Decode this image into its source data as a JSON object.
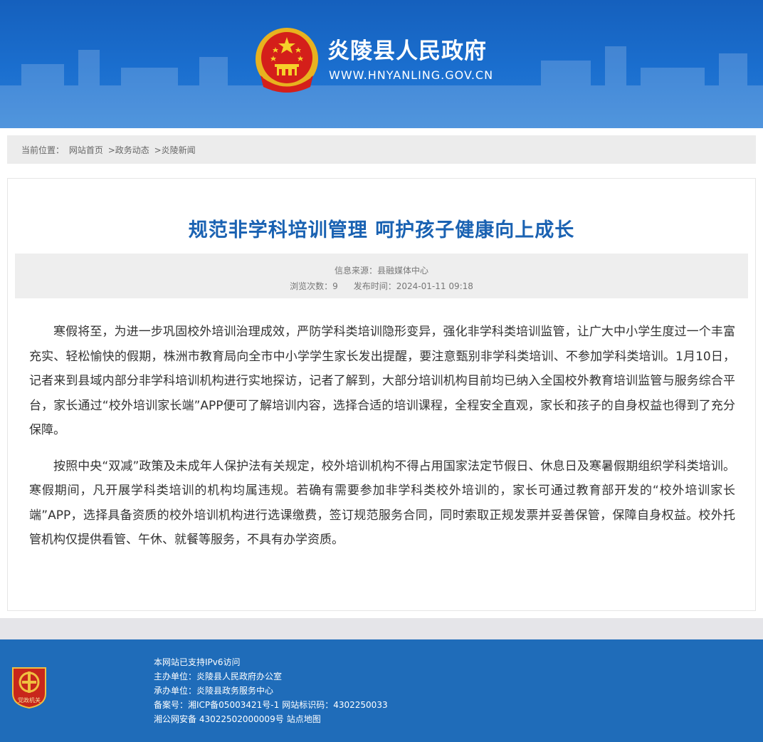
{
  "header": {
    "title": "炎陵县人民政府",
    "url": "WWW.HNYANLING.GOV.CN",
    "emblem_icon": "national-emblem-icon"
  },
  "breadcrumb": {
    "label": "当前位置：",
    "items": [
      "网站首页",
      ">政务动态",
      ">炎陵新闻"
    ]
  },
  "article": {
    "title": "规范非学科培训管理 呵护孩子健康向上成长",
    "source_label": "信息来源：",
    "source": "县融媒体中心",
    "views_label": "浏览次数：",
    "views": "9",
    "published_label": "发布时间：",
    "published": "2024-01-11 09:18",
    "paragraphs": [
      "寒假将至，为进一步巩固校外培训治理成效，严防学科类培训隐形变异，强化非学科类培训监管，让广大中小学生度过一个丰富充实、轻松愉快的假期，株洲市教育局向全市中小学学生家长发出提醒，要注意甄别非学科类培训、不参加学科类培训。1月10日，记者来到县域内部分非学科培训机构进行实地探访，记者了解到，大部分培训机构目前均已纳入全国校外教育培训监管与服务综合平台，家长通过“校外培训家长端”APP便可了解培训内容，选择合适的培训课程，全程安全直观，家长和孩子的自身权益也得到了充分保障。",
      "按照中央“双减”政策及未成年人保护法有关规定，校外培训机构不得占用国家法定节假日、休息日及寒暑假期组织学科类培训。寒假期间，凡开展学科类培训的机构均属违规。若确有需要参加非学科类校外培训的，家长可通过教育部开发的“校外培训家长端”APP，选择具备资质的校外培训机构进行选课缴费，签订规范服务合同，同时索取正规发票并妥善保管，保障自身权益。校外托管机构仅提供看管、午休、就餐等服务，不具有办学资质。"
    ]
  },
  "footer": {
    "ipv6": "本网站已支持IPv6访问",
    "host_label": "主办单位：",
    "host": "炎陵县人民政府办公室",
    "operator_label": "承办单位：",
    "operator": "炎陵县政务服务中心",
    "icp_label": "备案号：",
    "icp": "湘ICP备05003421号-1",
    "site_id_label": "网站标识码：",
    "site_id": "4302250033",
    "police": "湘公网安备 43022502000009号",
    "sitemap": "站点地图",
    "badge_text": "党政机关",
    "badge_icon": "party-government-badge-icon"
  },
  "colors": {
    "header_blue": "#1b6fcf",
    "title_blue": "#1a62b2",
    "footer_blue": "#1f6cb9",
    "badge_red": "#c8271b"
  }
}
